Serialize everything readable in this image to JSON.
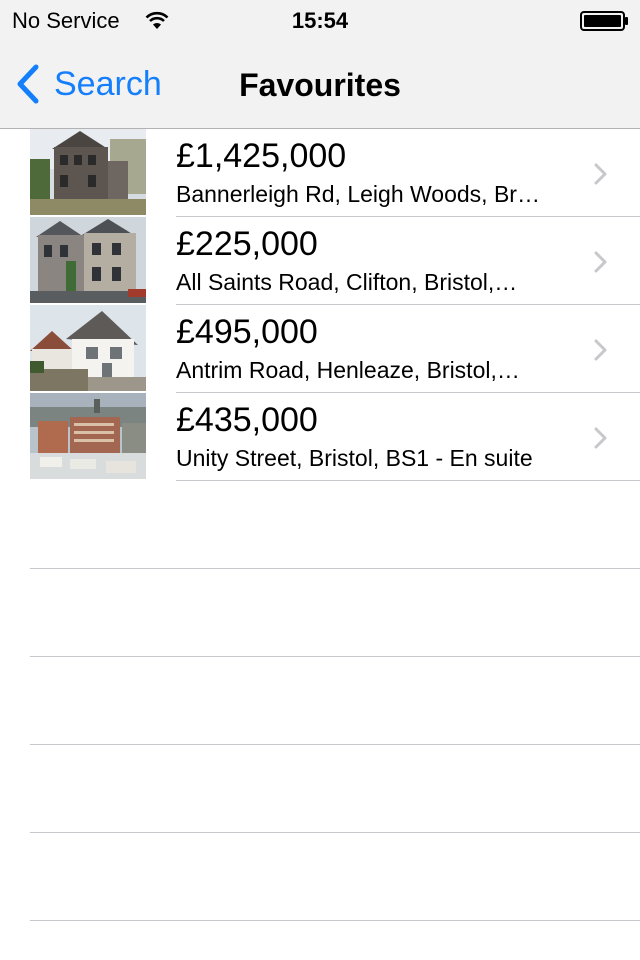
{
  "status_bar": {
    "carrier": "No Service",
    "time": "15:54",
    "icons": [
      "wifi-icon",
      "battery-icon"
    ]
  },
  "nav": {
    "back_label": "Search",
    "title": "Favourites",
    "accent_color": "#157efb"
  },
  "listings": [
    {
      "price": "£1,425,000",
      "address": "Bannerleigh Rd, Leigh Woods, Br…",
      "thumbnail": "stone-house-photo"
    },
    {
      "price": "£225,000",
      "address": "All Saints Road, Clifton, Bristol,…",
      "thumbnail": "terraced-house-photo"
    },
    {
      "price": "£495,000",
      "address": "Antrim Road, Henleaze, Bristol,…",
      "thumbnail": "white-house-photo"
    },
    {
      "price": "£435,000",
      "address": "Unity Street, Bristol, BS1 - En suite",
      "thumbnail": "city-view-photo"
    }
  ]
}
